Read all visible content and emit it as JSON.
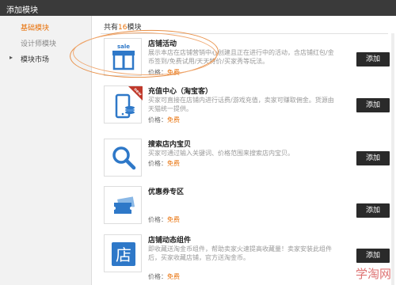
{
  "window": {
    "title": "添加模块"
  },
  "sidebar": {
    "items": [
      {
        "label": "基础模块",
        "state": "active"
      },
      {
        "label": "设计师模块",
        "state": "muted"
      },
      {
        "label": "模块市场",
        "state": "normal"
      }
    ]
  },
  "main": {
    "count_prefix": "共有",
    "count_value": "16",
    "count_suffix": "模块",
    "modules": [
      {
        "title": "店铺活动",
        "desc": "展示本店在店铺营销中心创建且正在进行中的活动，含店铺红包/金币签到/免费试用/天天特价/买家秀等玩法。",
        "price_label": "价格：",
        "price_value": "免费",
        "add_label": "添加",
        "icon": "gift-sale-icon"
      },
      {
        "title": "充值中心（淘宝客）",
        "desc": "买家可直接在店铺内进行话费/游戏充值，卖家可赚取佣金。货源由天猫统一提供。",
        "price_label": "价格：",
        "price_value": "免费",
        "add_label": "添加",
        "icon": "phone-recharge-icon",
        "badge": "new"
      },
      {
        "title": "搜索店内宝贝",
        "desc": "买家可通过输入关键词、价格范围来搜索店内宝贝。",
        "price_label": "价格：",
        "price_value": "免费",
        "add_label": "添加",
        "icon": "search-icon"
      },
      {
        "title": "优惠券专区",
        "desc": "",
        "price_label": "价格：",
        "price_value": "免费",
        "add_label": "添加",
        "icon": "coupon-icon"
      },
      {
        "title": "店铺动态组件",
        "desc": "即收藏送淘金币组件，帮助卖家火速提高收藏量！卖家安装此组件后，买家收藏店铺，官方送淘金币。",
        "price_label": "价格：",
        "price_value": "免费",
        "add_label": "添加",
        "icon": "store-icon"
      }
    ]
  },
  "watermark": "学淘网",
  "colors": {
    "accent": "#e8710a",
    "icon_blue": "#2e78c8",
    "button": "#2a2a2a"
  }
}
